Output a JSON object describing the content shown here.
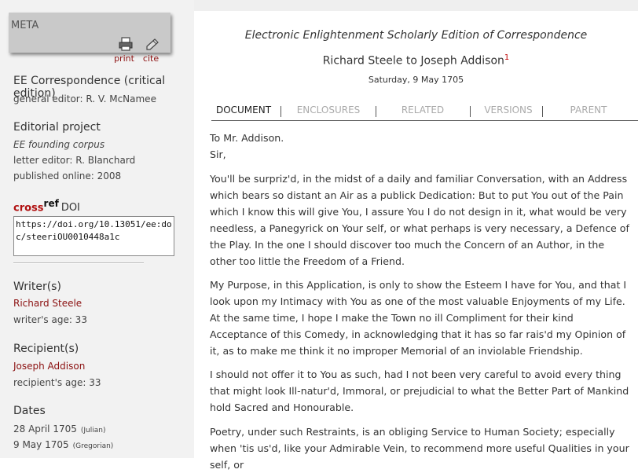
{
  "meta": {
    "title": "META",
    "print_label": "print",
    "cite_label": "cite"
  },
  "sidebar": {
    "edition_title": "EE Correspondence (critical edition)",
    "general_editor": "general editor: R. V. McNamee",
    "project_heading": "Editorial project",
    "project_name": "EE founding corpus",
    "letter_editor": "letter editor: R. Blanchard",
    "published_online": "published online: 2008",
    "crossref_cross": "cross",
    "crossref_ref": "ref",
    "crossref_doi": "DOI",
    "doi_value": "https://doi.org/10.13051/ee:doc/steeriOU0010448a1c",
    "writers_heading": "Writer(s)",
    "writer_name": "Richard Steele",
    "writer_age": "writer's age:  33",
    "recipients_heading": "Recipient(s)",
    "recipient_name": "Joseph Addison",
    "recipient_age": "recipient's age:  33",
    "dates_heading": "Dates",
    "date_julian": "28 April 1705",
    "julian_label": "(Julian)",
    "date_gregorian": "9 May 1705",
    "gregorian_label": "(Gregorian)"
  },
  "header": {
    "edition_title": "Electronic Enlightenment Scholarly Edition of Correspondence",
    "letter_title": "Richard Steele to Joseph Addison",
    "footnote_mark": "1",
    "date": "Saturday, 9 May 1705"
  },
  "tabs": [
    {
      "label": "DOCUMENT",
      "active": true
    },
    {
      "label": "ENCLOSURES",
      "active": false
    },
    {
      "label": "RELATED",
      "active": false
    },
    {
      "label": "VERSIONS",
      "active": false
    },
    {
      "label": "PARENT",
      "active": false
    }
  ],
  "letter": {
    "salutation_1": "To Mr. Addison.",
    "salutation_2": "Sir,",
    "paragraphs": [
      "You'll be surpriz'd, in the midst of a daily and familiar Conversation, with an Address which bears so distant an Air as a publick Dedication: But to put You out of the Pain which I know this will give You, I assure You I do not design in it, what would be very needless, a Panegyrick on Your self, or what perhaps is very necessary, a Defence of the Play. In the one I should discover too much the Concern of an Author, in the other too little the Freedom of a Friend.",
      "My Purpose, in this Application, is only to show the Esteem I have for You, and that I look upon my Intimacy with You as one of the most valuable Enjoyments of my Life. At the same time, I hope I make the Town no ill Compliment for their kind Acceptance of this Comedy, in acknowledging that it has so far rais'd my Opinion of it, as to make me think it no improper Memorial of an inviolable Friendship.",
      "I should not offer it to You as such, had I not been very careful to avoid every thing that might look Ill-natur'd, Immoral, or prejudicial to what the Better Part of Mankind hold Sacred and Honourable.",
      "Poetry, under such Restraints, is an obliging Service to Human Society; especially when 'tis us'd, like your Admirable Vein, to recommend more useful Qualities in your self, or"
    ]
  }
}
